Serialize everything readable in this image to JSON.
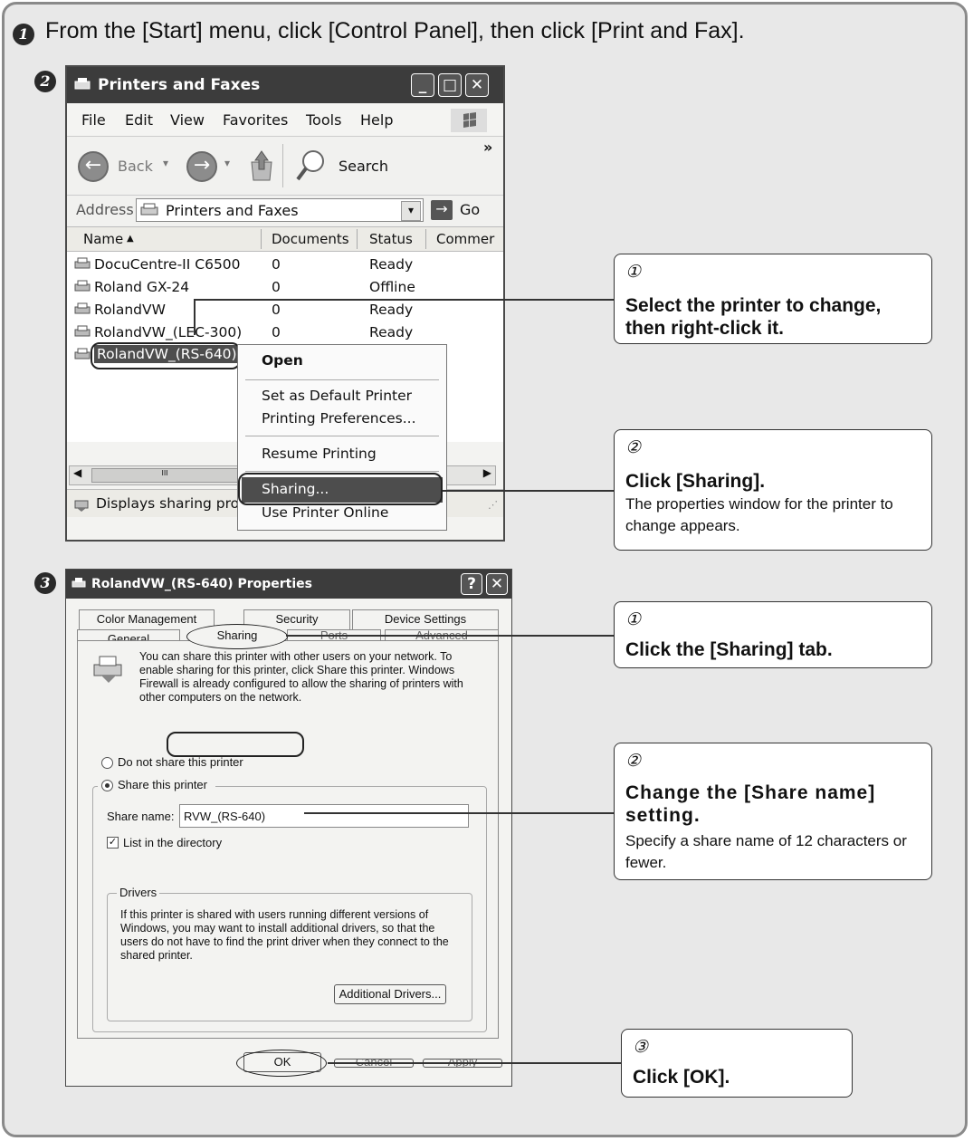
{
  "step1": {
    "badge": "1",
    "text": "From the [Start] menu, click [Control Panel], then click [Print and Fax]."
  },
  "step2": {
    "badge": "2",
    "window": {
      "title": "Printers and Faxes",
      "menu": [
        "File",
        "Edit",
        "View",
        "Favorites",
        "Tools",
        "Help"
      ],
      "toolbar": {
        "back": "Back",
        "search": "Search",
        "more": "»"
      },
      "address": {
        "label": "Address",
        "value": "Printers and Faxes",
        "go": "Go"
      },
      "columns": [
        "Name",
        "Documents",
        "Status",
        "Commer"
      ],
      "rows": [
        {
          "name": "DocuCentre-II C6500",
          "docs": "0",
          "status": "Ready"
        },
        {
          "name": "Roland GX-24",
          "docs": "0",
          "status": "Offline"
        },
        {
          "name": "RolandVW",
          "docs": "0",
          "status": "Ready"
        },
        {
          "name": "RolandVW_(LEC-300)",
          "docs": "0",
          "status": "Ready"
        },
        {
          "name": "RolandVW_(RS-640)",
          "docs": "",
          "status": ""
        }
      ],
      "status_text": "Displays sharing prop",
      "scroll_thumb": "III"
    },
    "context_menu": [
      "Open",
      "Set as Default Printer",
      "Printing Preferences...",
      "Resume Printing",
      "Sharing...",
      "Use Printer Online"
    ],
    "callouts": [
      {
        "num": "①",
        "head": "Select the printer to change, then right-click it.",
        "body": ""
      },
      {
        "num": "②",
        "head": "Click [Sharing].",
        "body": "The properties window for the printer to change appears."
      }
    ]
  },
  "step3": {
    "badge": "3",
    "dialog": {
      "title": "RolandVW_(RS-640) Properties",
      "tabs_top": [
        "Color Management",
        "Security",
        "Device Settings"
      ],
      "tabs_bottom": [
        "General",
        "Sharing",
        "Ports",
        "Advanced"
      ],
      "intro": "You can share this printer with other users on your network.  To enable sharing for this printer, click Share this printer.  Windows Firewall is already configured to allow the sharing of printers with other computers on the network.",
      "option_no_share": "Do not share this printer",
      "option_share": "Share this printer",
      "share_name_label": "Share name:",
      "share_name_value": "RVW_(RS-640)",
      "list_in_directory": "List in the directory",
      "drivers_label": "Drivers",
      "drivers_text": "If this printer is shared with users running different versions of Windows, you may want to install additional drivers, so that the users do not have to find the print driver when they connect to the shared printer.",
      "additional_drivers": "Additional Drivers...",
      "ok": "OK",
      "cancel": "Cancel",
      "apply": "Apply"
    },
    "callouts": [
      {
        "num": "①",
        "head": "Click the [Sharing] tab.",
        "body": ""
      },
      {
        "num": "②",
        "head": "Change the [Share name] setting.",
        "body": "Specify a share name of 12 characters or fewer."
      },
      {
        "num": "③",
        "head": "Click [OK].",
        "body": ""
      }
    ]
  }
}
